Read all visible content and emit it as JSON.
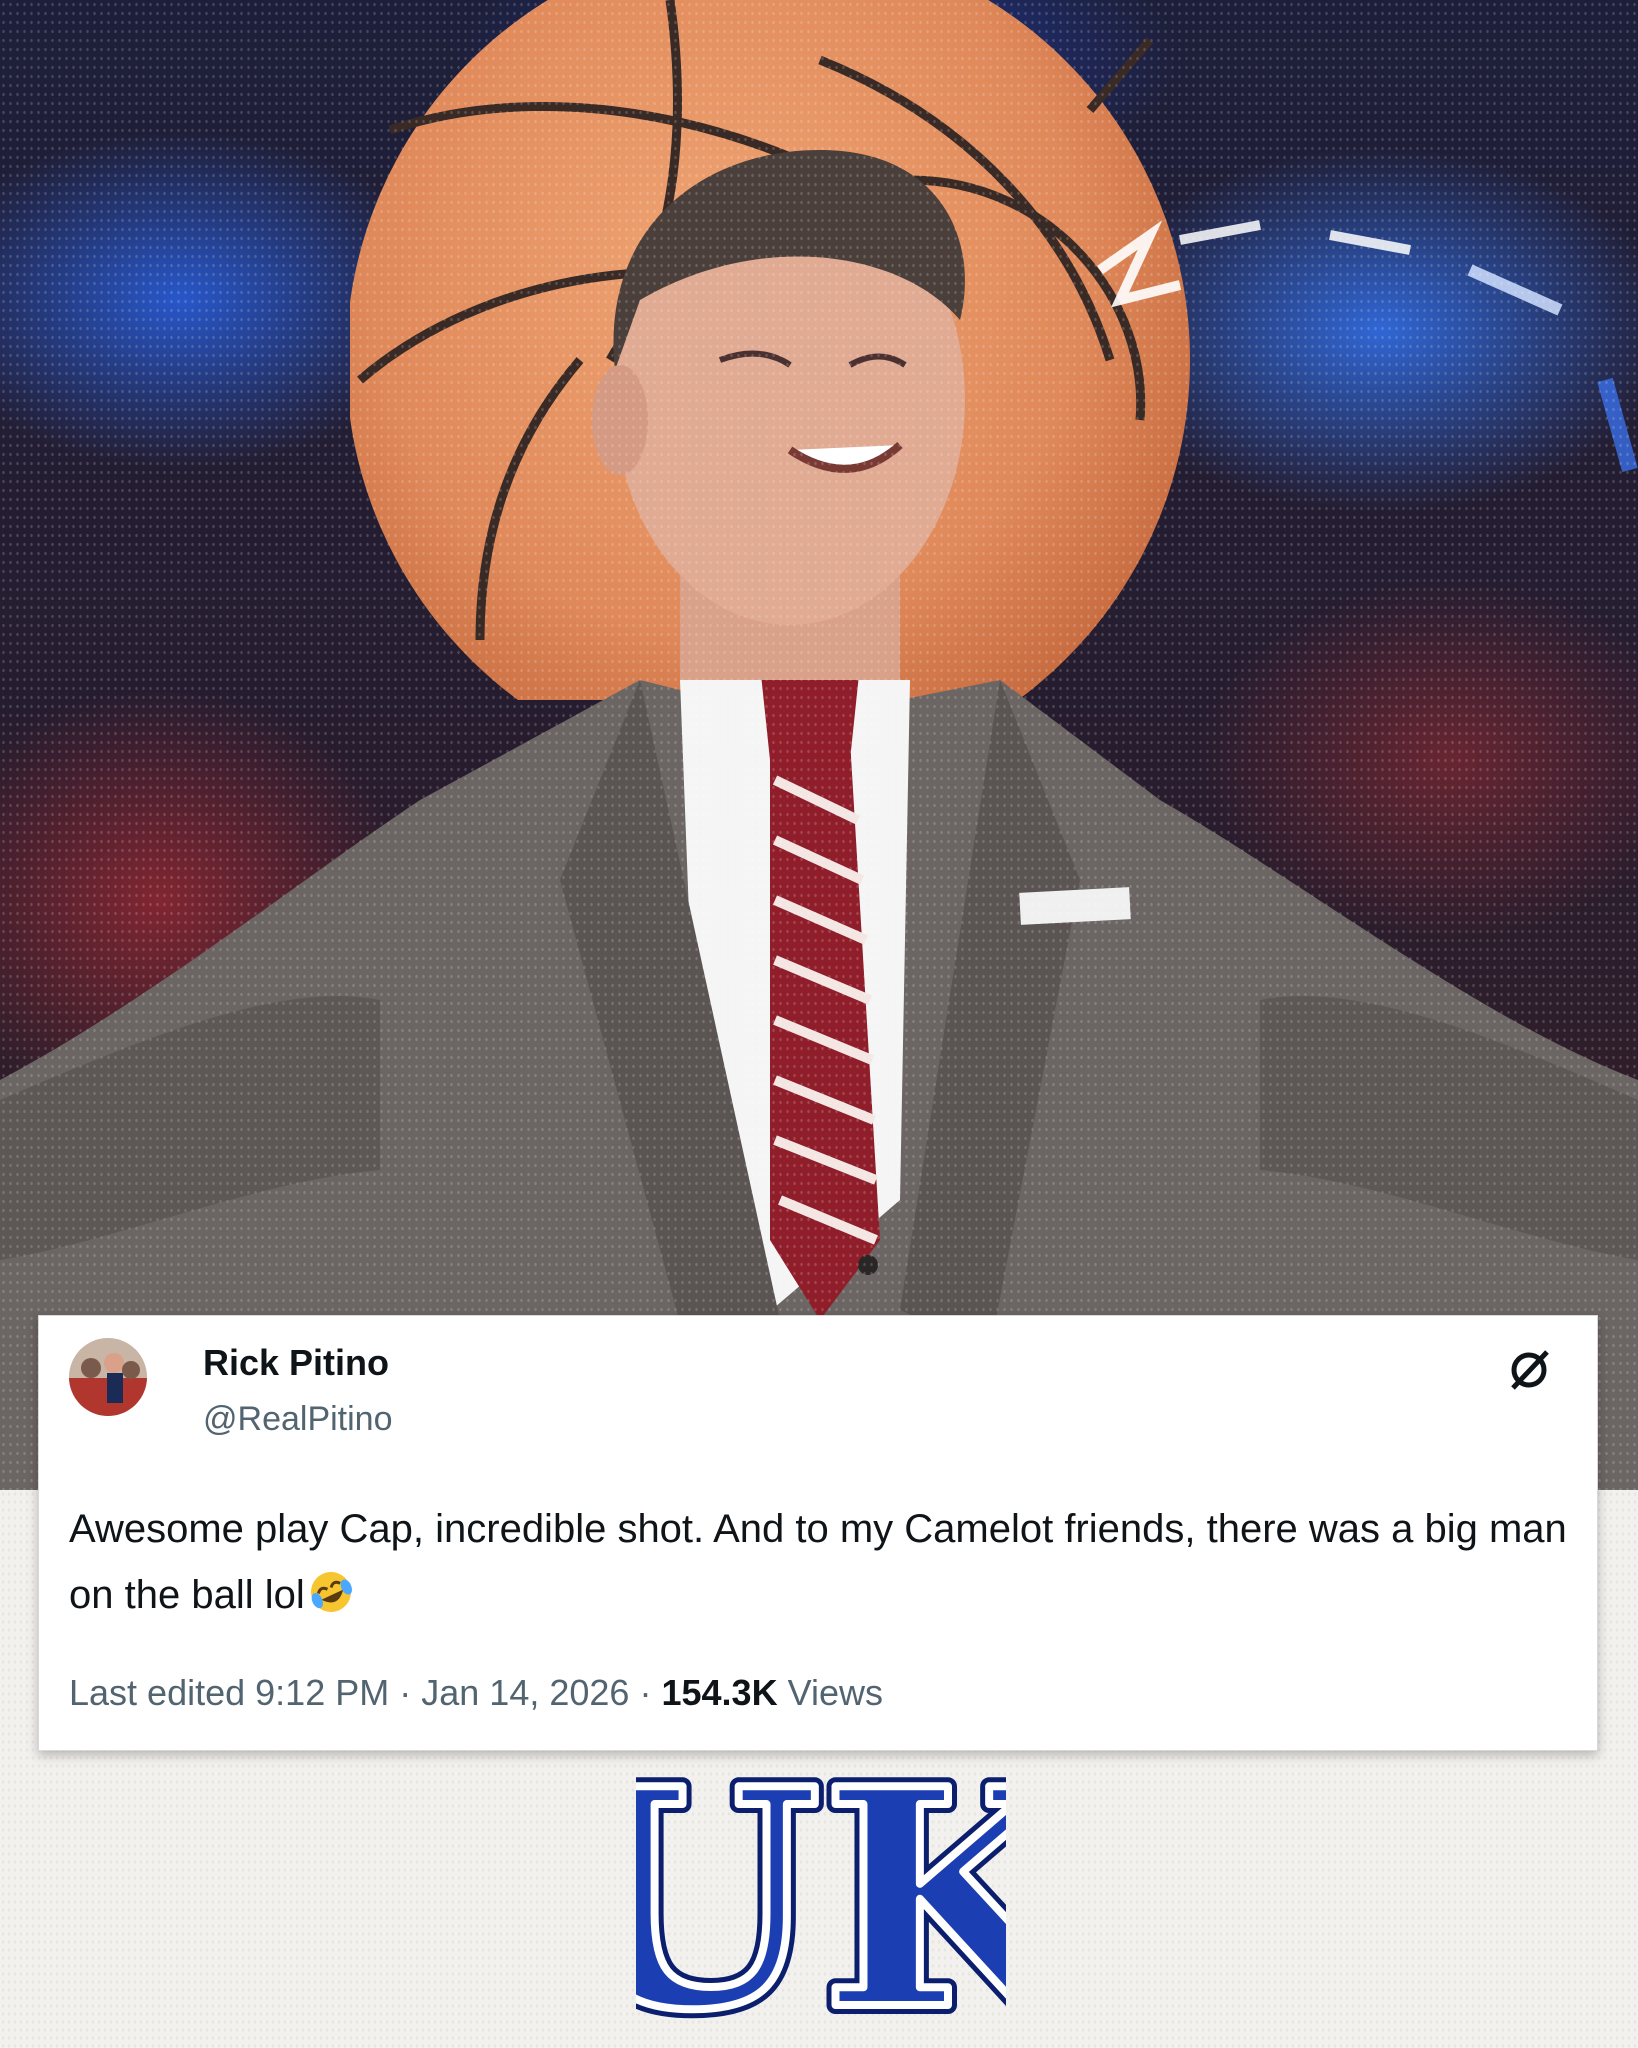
{
  "tweet": {
    "display_name": "Rick Pitino",
    "handle": "@RealPitino",
    "text": "Awesome play Cap, incredible shot. And to my Camelot friends, there was a big man on the ball lol",
    "emoji": "rolling-on-floor-laughing-emoji",
    "timestamp_prefix": "Last edited",
    "time": "9:12 PM",
    "separator": "·",
    "date": "Jan 14, 2026",
    "views_count": "154.3K",
    "views_label": "Views"
  },
  "logo": {
    "text": "UK",
    "colors": {
      "fill": "#1b3fb3",
      "outline": "#ffffff",
      "edge": "#0b1f6e"
    }
  },
  "colors": {
    "ball": "#e0895a",
    "suit": "#6b6563",
    "tie_stripe_dark": "#8f1d2a",
    "tie_stripe_light": "#f3e6e3"
  }
}
